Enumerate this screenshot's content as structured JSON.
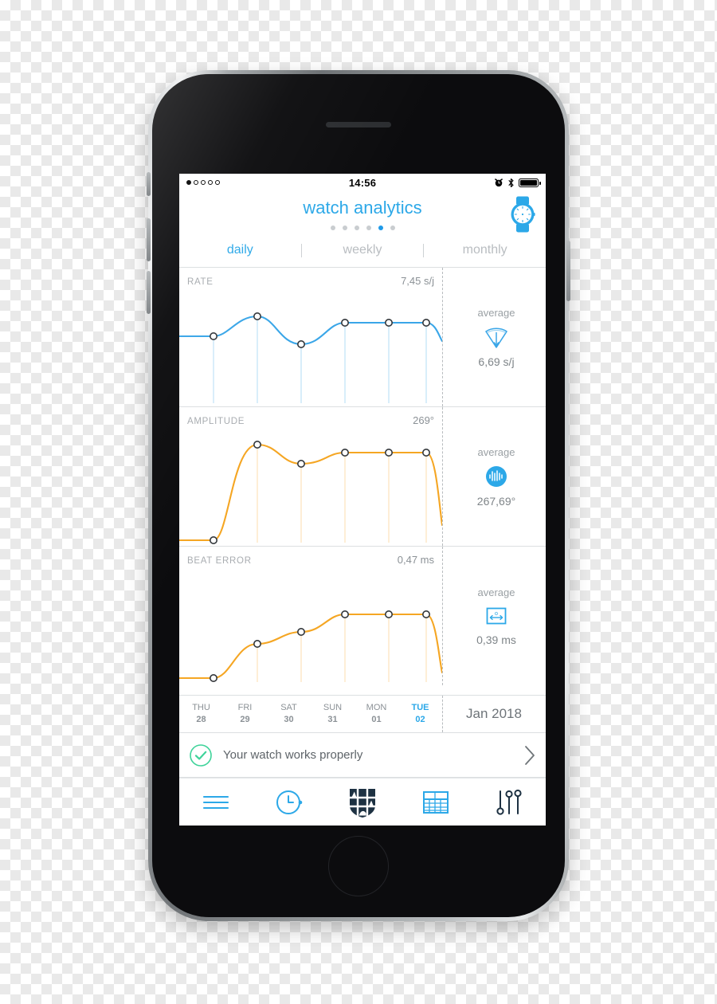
{
  "status_bar": {
    "time": "14:56",
    "signal_dots_total": 5,
    "signal_dots_filled": 1,
    "icons": [
      "alarm-icon",
      "bluetooth-icon",
      "battery-icon"
    ]
  },
  "header": {
    "title": "watch analytics",
    "watch_icon": "watch-icon",
    "page_dots_total": 6,
    "page_dots_active_index": 4
  },
  "tabs": [
    {
      "label": "daily",
      "active": true
    },
    {
      "label": "weekly",
      "active": false
    },
    {
      "label": "monthly",
      "active": false
    }
  ],
  "colors": {
    "accent_blue": "#2ca8e8",
    "rate_line": "#3aa6e8",
    "amplitude_line": "#f5a623",
    "beat_error_line": "#f5a623",
    "success_green": "#3fd39a",
    "text_gray": "#8b9196",
    "dark_navy": "#1d3142"
  },
  "chart_data": [
    {
      "type": "line",
      "title": "RATE",
      "max_label": "7,45 s/j",
      "average_label": "average",
      "average_value": "6,69 s/j",
      "average_icon": "rate-cone-icon",
      "unit": "s/j",
      "color": "#3aa6e8",
      "categories": [
        "THU 28",
        "FRI 29",
        "SAT 30",
        "SUN 31",
        "MON 01",
        "TUE 02"
      ],
      "values": [
        6.1,
        7.45,
        6.55,
        7.2,
        7.2,
        7.2
      ],
      "ylim": [
        0,
        8
      ],
      "grid": false,
      "legend": "none"
    },
    {
      "type": "line",
      "title": "AMPLITUDE",
      "max_label": "269°",
      "average_label": "average",
      "average_value": "267,69°",
      "average_icon": "amplitude-wave-icon",
      "unit": "°",
      "color": "#f5a623",
      "categories": [
        "THU 28",
        "FRI 29",
        "SAT 30",
        "SUN 31",
        "MON 01",
        "TUE 02"
      ],
      "values": [
        0,
        269,
        256,
        263,
        263,
        263
      ],
      "ylim": [
        0,
        275
      ],
      "grid": false,
      "legend": "none"
    },
    {
      "type": "line",
      "title": "BEAT ERROR",
      "max_label": "0,47 ms",
      "average_label": "average",
      "average_value": "0,39 ms",
      "average_icon": "beat-error-box-icon",
      "unit": "ms",
      "color": "#f5a623",
      "categories": [
        "THU 28",
        "FRI 29",
        "SAT 30",
        "SUN 31",
        "MON 01",
        "TUE 02"
      ],
      "values": [
        0.02,
        0.2,
        0.28,
        0.47,
        0.47,
        0.47
      ],
      "ylim": [
        0,
        0.52
      ],
      "grid": false,
      "legend": "none"
    }
  ],
  "date_axis": {
    "days": [
      {
        "dow": "THU",
        "num": "28",
        "active": false
      },
      {
        "dow": "FRI",
        "num": "29",
        "active": false
      },
      {
        "dow": "SAT",
        "num": "30",
        "active": false
      },
      {
        "dow": "SUN",
        "num": "31",
        "active": false
      },
      {
        "dow": "MON",
        "num": "01",
        "active": false
      },
      {
        "dow": "TUE",
        "num": "02",
        "active": true
      }
    ],
    "month": "Jan 2018"
  },
  "status_row": {
    "icon": "check-circle-icon",
    "text": "Your watch works properly",
    "chevron": "chevron-right-icon"
  },
  "tabbar": [
    {
      "name": "menu-icon",
      "active": false
    },
    {
      "name": "clock-icon",
      "active": false
    },
    {
      "name": "crest-icon",
      "active": true
    },
    {
      "name": "calendar-icon",
      "active": false
    },
    {
      "name": "settings-sliders-icon",
      "active": false
    }
  ]
}
